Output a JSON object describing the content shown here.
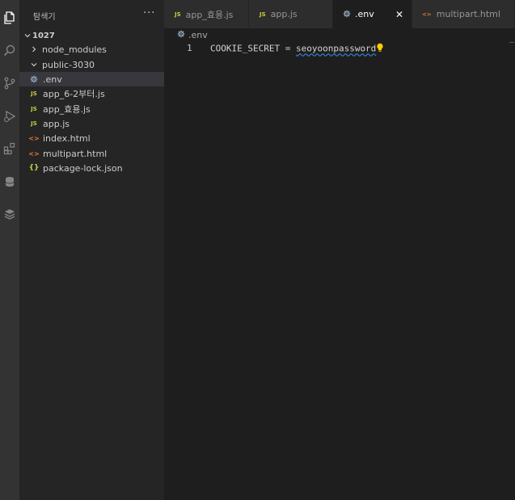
{
  "activity_bar": {
    "icons": [
      "explorer-icon",
      "search-icon",
      "source-control-icon",
      "run-debug-icon",
      "extensions-icon",
      "database-icon",
      "layers-icon"
    ]
  },
  "sidebar": {
    "title": "탐색기",
    "more": "···",
    "root": "1027",
    "items": [
      {
        "label": "node_modules",
        "type": "folder"
      },
      {
        "label": "public-3030",
        "type": "folder"
      },
      {
        "label": ".env",
        "type": "env"
      },
      {
        "label": "app_6-2부터.js",
        "type": "js"
      },
      {
        "label": "app_효용.js",
        "type": "js"
      },
      {
        "label": "app.js",
        "type": "js"
      },
      {
        "label": "index.html",
        "type": "html"
      },
      {
        "label": "multipart.html",
        "type": "html"
      },
      {
        "label": "package-lock.json",
        "type": "json"
      }
    ]
  },
  "tabs": [
    {
      "label": "app_효용.js",
      "icon": "JS"
    },
    {
      "label": "app.js",
      "icon": "JS"
    },
    {
      "label": ".env",
      "icon": "gear"
    },
    {
      "label": "multipart.html",
      "icon": "<>"
    }
  ],
  "breadcrumb": {
    "file": ".env"
  },
  "editor": {
    "line_number": "1",
    "code_key": "COOKIE_SECRET = ",
    "code_value": "seoyoonpassword"
  },
  "colors": {
    "js": "#cbcb41",
    "html": "#e37933",
    "squiggle": "#3794ff",
    "bulb": "#ffcc00"
  }
}
